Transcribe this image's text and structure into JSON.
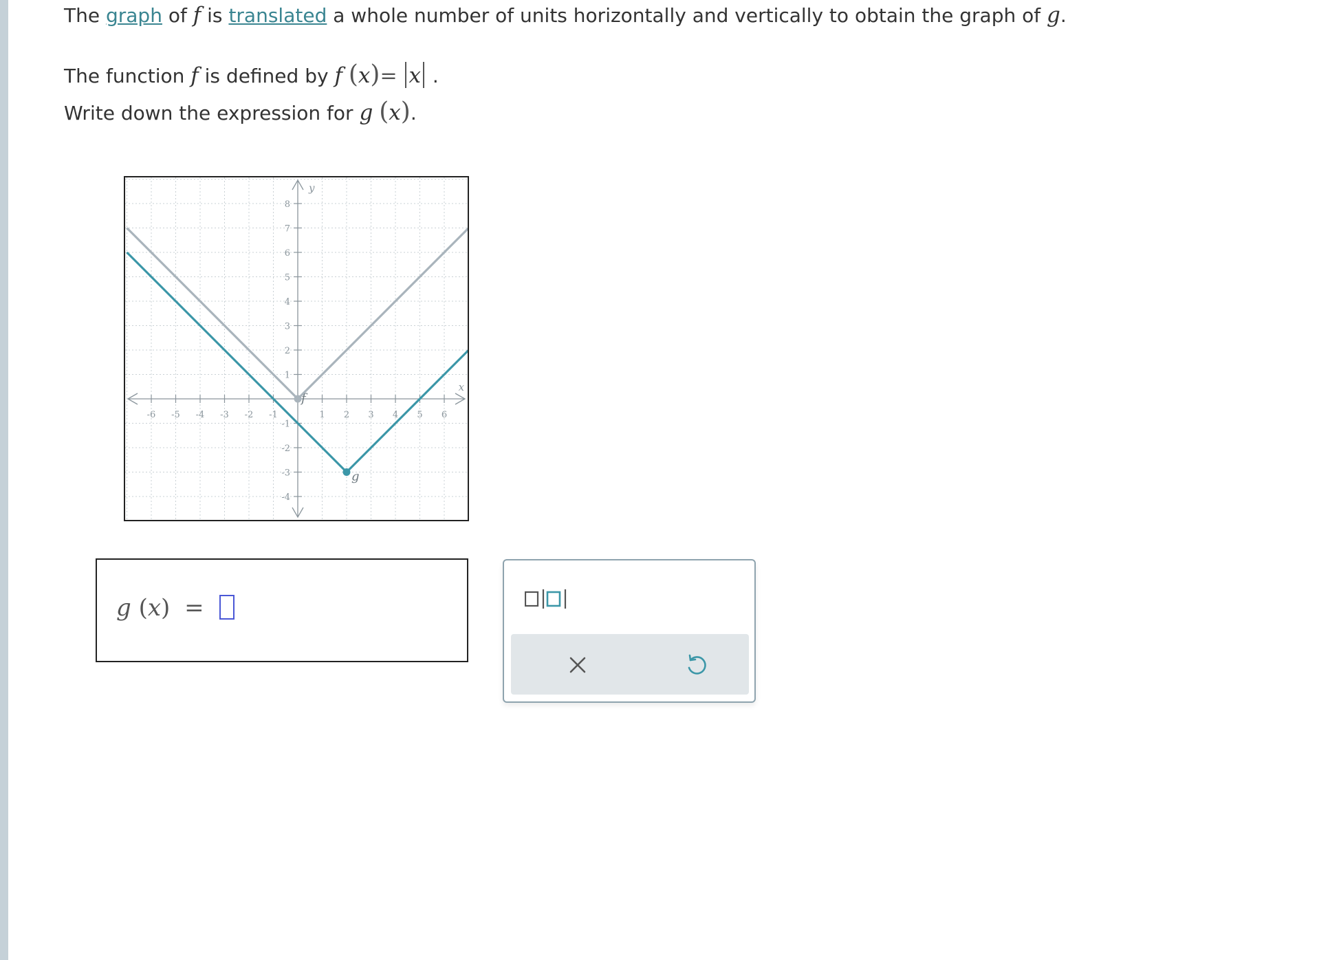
{
  "question": {
    "line1": {
      "t1": "The",
      "link1": "graph",
      "t2": "of",
      "f": "f",
      "t3": "is",
      "link2": "translated",
      "t4": "a whole number of units horizontally and vertically to obtain the graph of",
      "g": "g",
      "end": "."
    },
    "line2": {
      "t1": "The function",
      "f": "f",
      "t2": "is defined by",
      "lhs": "f",
      "x": "x",
      "eq": "=",
      "absx": "x",
      "end": "."
    },
    "line3": {
      "t1": "Write down the expression for",
      "g": "g",
      "x": "x",
      "end": "."
    }
  },
  "graph": {
    "x_ticks": [
      "-6",
      "-5",
      "-4",
      "-3",
      "-2",
      "-1",
      "1",
      "2",
      "3",
      "4",
      "5",
      "6"
    ],
    "y_ticks": [
      "8",
      "7",
      "6",
      "5",
      "4",
      "3",
      "2",
      "1",
      "-1",
      "-2",
      "-3",
      "-4"
    ],
    "x_axis_label": "x",
    "y_axis_label": "y",
    "f_label": "f",
    "g_label": "g",
    "f_color": "#a9b4bc",
    "g_color": "#3c97a8",
    "xlim": [
      -7,
      7
    ],
    "ylim": [
      -5,
      9
    ],
    "f_vertex": [
      0,
      0
    ],
    "g_vertex": [
      2,
      -3
    ]
  },
  "answer": {
    "lhs": "g",
    "x": "x",
    "eq": "="
  },
  "keypad": {
    "abs_icon": "absolute-value-template-icon",
    "clear_icon": "close-icon",
    "undo_icon": "undo-icon"
  }
}
